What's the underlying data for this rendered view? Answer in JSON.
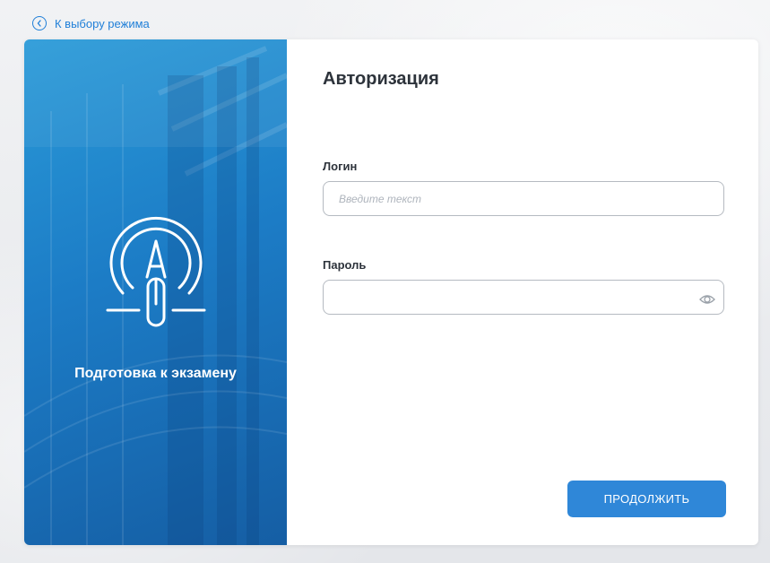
{
  "nav": {
    "back_label": "К выбору режима"
  },
  "mode_panel": {
    "title": "Подготовка к экзамену"
  },
  "auth": {
    "title": "Авторизация",
    "login_label": "Логин",
    "login_placeholder": "Введите текст",
    "login_value": "",
    "password_label": "Пароль",
    "password_value": "",
    "continue_label": "ПРОДОЛЖИТЬ"
  },
  "icons": {
    "back": "chevron-left-circle-icon",
    "mode": "exam-compass-icon",
    "password_toggle": "eye-icon"
  },
  "colors": {
    "accent": "#2f87d8",
    "link": "#1f7fd8",
    "panel": "#1c7cc6"
  }
}
